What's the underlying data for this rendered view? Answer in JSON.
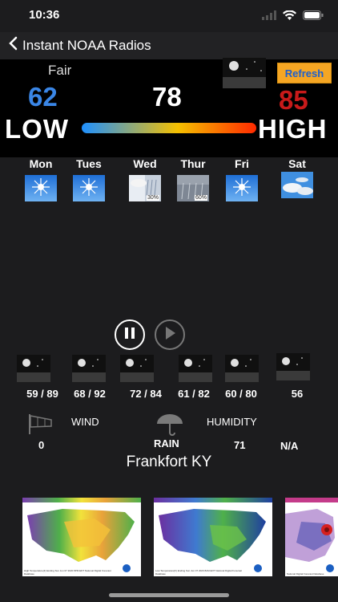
{
  "status": {
    "time": "10:36"
  },
  "nav": {
    "back_label": "Instant NOAA Radios"
  },
  "current": {
    "condition": "Fair",
    "low": "62",
    "temp": "78",
    "high": "85",
    "refresh_label": "Refresh",
    "low_word": "LOW",
    "high_word": "HIGH"
  },
  "week": [
    {
      "day": "Mon",
      "icon": "sunny-icon",
      "pct": ""
    },
    {
      "day": "Tues",
      "icon": "sunny-icon",
      "pct": ""
    },
    {
      "day": "Wed",
      "icon": "rain-showers-icon",
      "pct": "30%"
    },
    {
      "day": "Thur",
      "icon": "rain-icon",
      "pct": "60%"
    },
    {
      "day": "Fri",
      "icon": "sunny-icon",
      "pct": ""
    },
    {
      "day": "Sat",
      "icon": "partly-cloudy-icon",
      "pct": ""
    }
  ],
  "nights": [
    {
      "temps": "59 / 89"
    },
    {
      "temps": "68 / 92"
    },
    {
      "temps": "72 / 84"
    },
    {
      "temps": "61 / 82"
    },
    {
      "temps": "60 / 80"
    },
    {
      "temps": "56"
    }
  ],
  "conditions": {
    "wind_label": "WIND",
    "wind_value": "0",
    "rain_label": "RAIN",
    "humidity_label": "HUMIDITY",
    "humidity_value": "71",
    "na_value": "N/A"
  },
  "location": "Frankfort KY",
  "maps": [
    {
      "caption": "High Temperature(F) Ending Sun Jun 07 2020 8PM EDT  National Digital Forecast Database"
    },
    {
      "caption": "Low Temperature(F) Ending Sun Jun 07 2020 8AM EDT  National Digital Forecast Database"
    },
    {
      "caption": "National Digital Forecast Database"
    }
  ]
}
